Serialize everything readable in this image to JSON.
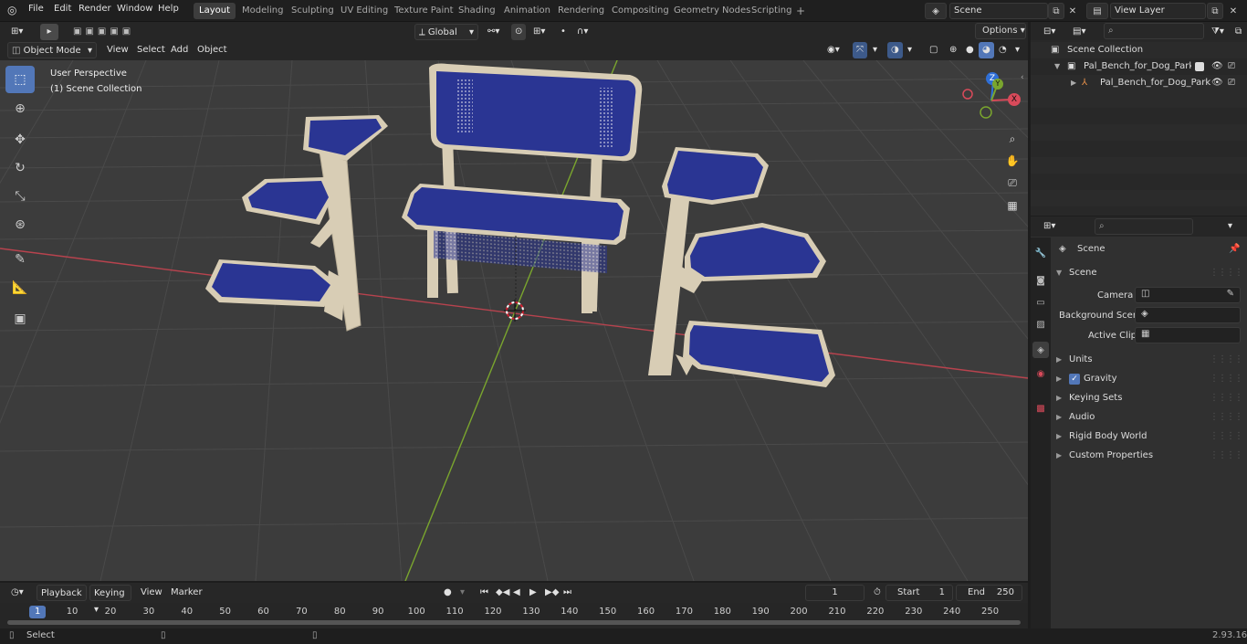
{
  "topbar": {
    "menus": [
      "File",
      "Edit",
      "Render",
      "Window",
      "Help"
    ],
    "workspaces": [
      "Layout",
      "Modeling",
      "Sculpting",
      "UV Editing",
      "Texture Paint",
      "Shading",
      "Animation",
      "Rendering",
      "Compositing",
      "Geometry Nodes",
      "Scripting"
    ],
    "active_workspace": "Layout",
    "add_tab": "+",
    "scene_name": "Scene",
    "view_layer": "View Layer"
  },
  "viewport": {
    "mode": "Object Mode",
    "menus": [
      "View",
      "Select",
      "Add",
      "Object"
    ],
    "orientation": "Global",
    "options": "Options",
    "overlay_line1": "User Perspective",
    "overlay_line2": "(1) Scene Collection",
    "gizmo": {
      "x": "X",
      "y": "Y",
      "z": "Z"
    }
  },
  "outliner": {
    "search_placeholder": "",
    "root": "Scene Collection",
    "collection": "Pal_Bench_for_Dog_Park_Blue",
    "object": "Pal_Bench_for_Dog_Park"
  },
  "properties": {
    "context": "Scene",
    "panel": "Scene",
    "camera_label": "Camera",
    "bg_label": "Background Scene",
    "clip_label": "Active Clip",
    "sections": [
      "Units",
      "Gravity",
      "Keying Sets",
      "Audio",
      "Rigid Body World",
      "Custom Properties"
    ],
    "gravity_checked": true
  },
  "timeline": {
    "menus": [
      "Playback",
      "Keying",
      "View",
      "Marker"
    ],
    "current_frame": "1",
    "start_label": "Start",
    "start": "1",
    "end_label": "End",
    "end": "250",
    "ticks": [
      "1",
      "10",
      "20",
      "30",
      "40",
      "50",
      "60",
      "70",
      "80",
      "90",
      "100",
      "110",
      "120",
      "130",
      "140",
      "150",
      "160",
      "170",
      "180",
      "190",
      "200",
      "210",
      "220",
      "230",
      "240",
      "250"
    ]
  },
  "status": {
    "left": "Select",
    "version": "2.93.16"
  },
  "colors": {
    "accent": "#5277b8",
    "seat_blue": "#2a3593",
    "frame": "#d8cdb5",
    "x_axis": "#b8434e",
    "y_axis": "#7aa52e"
  }
}
